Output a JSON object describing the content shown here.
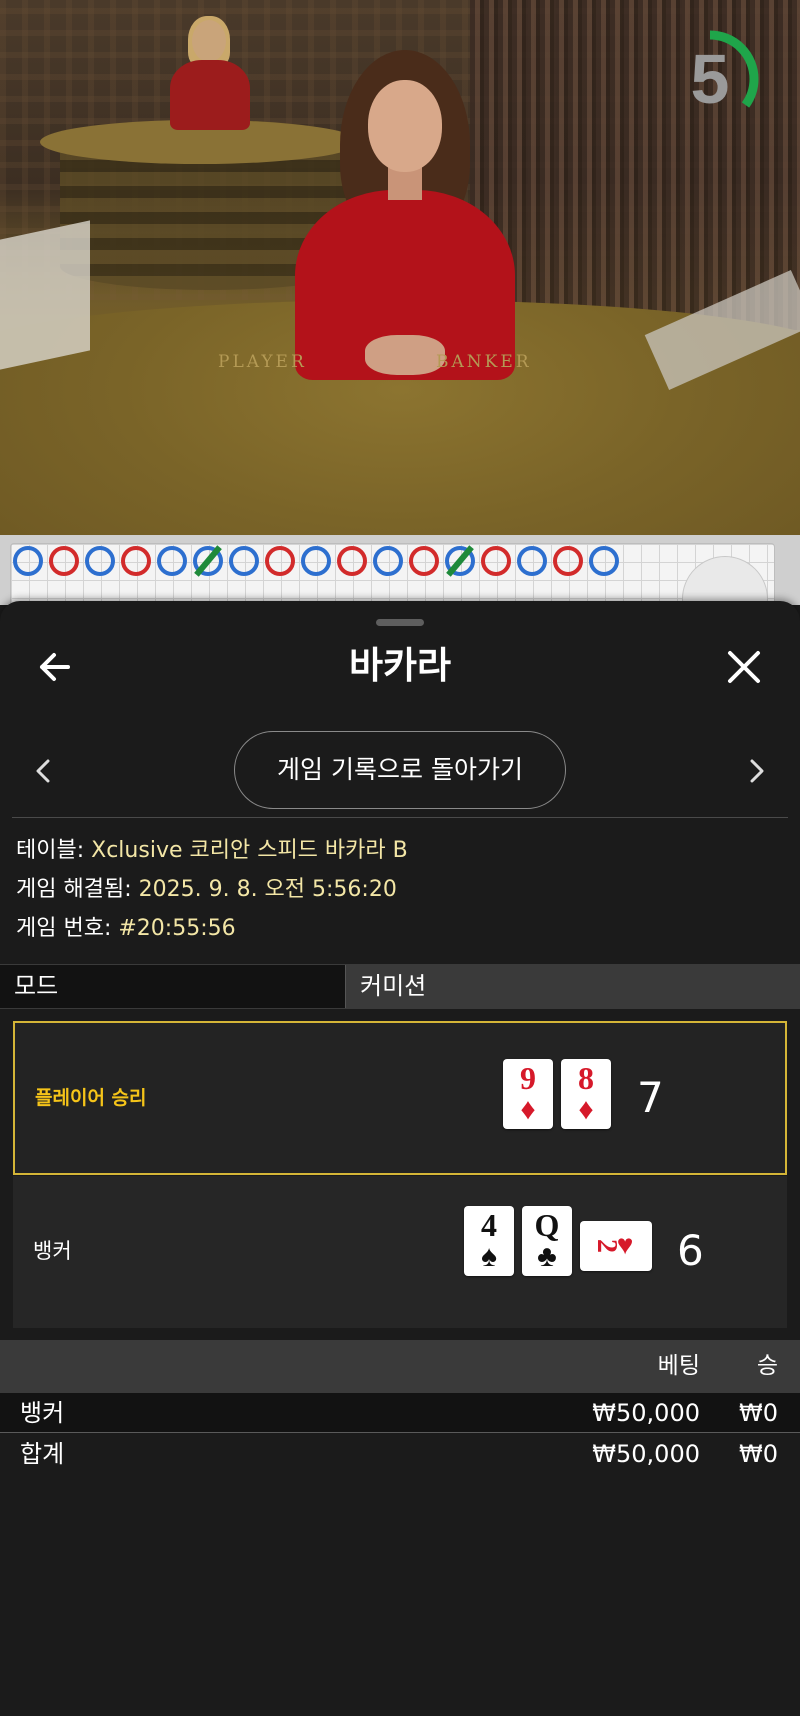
{
  "video": {
    "felt_player": "PLAYER",
    "felt_banker": "BANKER",
    "countdown": "5",
    "countdown_fraction": 0.35,
    "accent": "#1fa54a"
  },
  "roadmap": {
    "row1": [
      "B",
      "R",
      "B",
      "R",
      "B",
      "T",
      "B",
      "R",
      "B",
      "R",
      "B",
      "R",
      "T",
      "R",
      "B",
      "R",
      "B"
    ],
    "colors": {
      "banker": "#2d6fcf",
      "player": "#d22b2b",
      "tie": "#1f8a3a"
    }
  },
  "header": {
    "title": "바카라",
    "back_icon": "arrow-left-icon",
    "close_icon": "close-icon"
  },
  "nav": {
    "back_to_history": "게임 기록으로 돌아가기"
  },
  "details": {
    "table_label": "테이블:",
    "table_value": "Xclusive 코리안 스피드 바카라 B",
    "resolved_label": "게임 해결됨:",
    "resolved_value": "2025. 9. 8. 오전 5:56:20",
    "round_label": "게임 번호:",
    "round_value": "#20:55:56"
  },
  "tabs": {
    "mode": "모드",
    "commission": "커미션"
  },
  "hands": {
    "player": {
      "label": "플레이어 승리",
      "score": "7",
      "cards": [
        {
          "rank": "9",
          "suit": "♦",
          "color": "red"
        },
        {
          "rank": "8",
          "suit": "♦",
          "color": "red"
        }
      ]
    },
    "banker": {
      "label": "뱅커",
      "score": "6",
      "cards": [
        {
          "rank": "4",
          "suit": "♠",
          "color": "black"
        },
        {
          "rank": "Q",
          "suit": "♣",
          "color": "black"
        },
        {
          "rank": "2",
          "suit": "♥",
          "color": "red",
          "sideways": true
        }
      ]
    },
    "win_color": "#f5c419"
  },
  "bets": {
    "col_bet": "베팅",
    "col_win": "승",
    "rows": [
      {
        "name": "뱅커",
        "bet": "₩50,000",
        "win": "₩0"
      },
      {
        "name": "합계",
        "bet": "₩50,000",
        "win": "₩0"
      }
    ]
  }
}
